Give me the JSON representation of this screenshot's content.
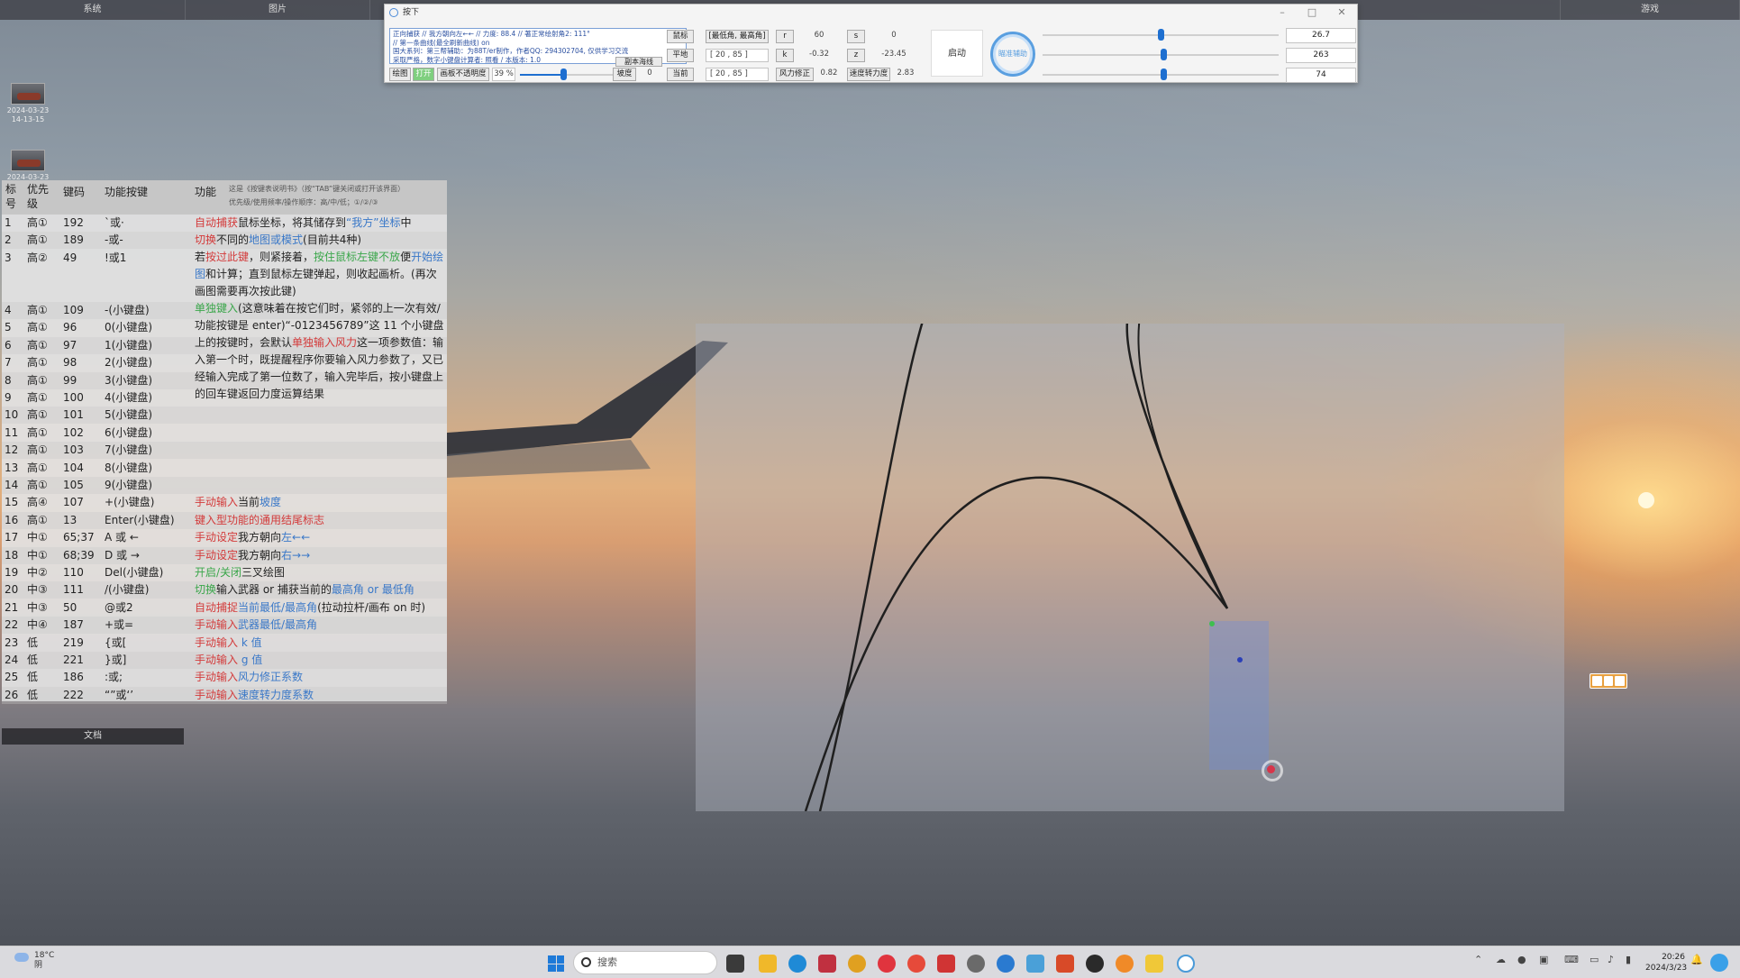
{
  "topbar": {
    "tabs": [
      "系统",
      "图片",
      "游戏"
    ]
  },
  "desktop_icons": [
    {
      "label": "2024-03-23 14-13-15"
    },
    {
      "label": "2024-03-23"
    }
  ],
  "table": {
    "headers": {
      "no": "标号",
      "priority": "优先级",
      "code": "键码",
      "key": "功能按键",
      "fn": "功能"
    },
    "header_note1": "这是《按键表说明书》（按“TAB”键关闭或打开该界面）",
    "header_note2": "优先级/使用频率/操作顺序：高/中/低；①/②/③",
    "rows": [
      {
        "no": "1",
        "pri": "高①",
        "code": "192",
        "key": "`或·",
        "fn": [
          {
            "t": "自动捕获",
            "c": "red"
          },
          {
            "t": "鼠标坐标，将其储存到"
          },
          {
            "t": "“我方”坐标",
            "c": "blue"
          },
          {
            "t": "中"
          }
        ]
      },
      {
        "no": "2",
        "pri": "高①",
        "code": "189",
        "key": "-或-",
        "fn": [
          {
            "t": "切换",
            "c": "red"
          },
          {
            "t": "不同的"
          },
          {
            "t": "地图或模式",
            "c": "blue"
          },
          {
            "t": "(目前共4种)"
          }
        ]
      },
      {
        "no": "3",
        "pri": "高②",
        "code": "49",
        "key": "!或1",
        "fn": []
      },
      {
        "no": "4",
        "pri": "高①",
        "code": "109",
        "key": "-(小键盘)",
        "fn": []
      },
      {
        "no": "5",
        "pri": "高①",
        "code": "96",
        "key": "0(小键盘)",
        "fn": []
      },
      {
        "no": "6",
        "pri": "高①",
        "code": "97",
        "key": "1(小键盘)",
        "fn": []
      },
      {
        "no": "7",
        "pri": "高①",
        "code": "98",
        "key": "2(小键盘)",
        "fn": []
      },
      {
        "no": "8",
        "pri": "高①",
        "code": "99",
        "key": "3(小键盘)",
        "fn": []
      },
      {
        "no": "9",
        "pri": "高①",
        "code": "100",
        "key": "4(小键盘)",
        "fn": []
      },
      {
        "no": "10",
        "pri": "高①",
        "code": "101",
        "key": "5(小键盘)",
        "fn": []
      },
      {
        "no": "11",
        "pri": "高①",
        "code": "102",
        "key": "6(小键盘)",
        "fn": []
      },
      {
        "no": "12",
        "pri": "高①",
        "code": "103",
        "key": "7(小键盘)",
        "fn": []
      },
      {
        "no": "13",
        "pri": "高①",
        "code": "104",
        "key": "8(小键盘)",
        "fn": []
      },
      {
        "no": "14",
        "pri": "高①",
        "code": "105",
        "key": "9(小键盘)",
        "fn": []
      },
      {
        "no": "15",
        "pri": "高④",
        "code": "107",
        "key": "+(小键盘)",
        "fn": [
          {
            "t": "手动输入",
            "c": "red"
          },
          {
            "t": "当前"
          },
          {
            "t": "坡度",
            "c": "blue"
          }
        ]
      },
      {
        "no": "16",
        "pri": "高①",
        "code": "13",
        "key": "Enter(小键盘)",
        "fn": [
          {
            "t": "键入型功能的通用结尾标志",
            "c": "red"
          }
        ]
      },
      {
        "no": "17",
        "pri": "中①",
        "code": "65;37",
        "key": "A 或 ←",
        "fn": [
          {
            "t": "手动设定",
            "c": "red"
          },
          {
            "t": "我方朝向"
          },
          {
            "t": "左←←",
            "c": "blue"
          }
        ]
      },
      {
        "no": "18",
        "pri": "中①",
        "code": "68;39",
        "key": "D 或 →",
        "fn": [
          {
            "t": "手动设定",
            "c": "red"
          },
          {
            "t": "我方朝向"
          },
          {
            "t": "右→→",
            "c": "blue"
          }
        ]
      },
      {
        "no": "19",
        "pri": "中②",
        "code": "110",
        "key": "Del(小键盘)",
        "fn": [
          {
            "t": "开启/关闭",
            "c": "green"
          },
          {
            "t": "三叉绘图"
          }
        ]
      },
      {
        "no": "20",
        "pri": "中③",
        "code": "111",
        "key": "/(小键盘)",
        "fn": [
          {
            "t": "切换",
            "c": "green"
          },
          {
            "t": "输入武器 or 捕获当前的"
          },
          {
            "t": "最高角 or 最低角",
            "c": "blue"
          }
        ]
      },
      {
        "no": "21",
        "pri": "中③",
        "code": "50",
        "key": "@或2",
        "fn": [
          {
            "t": "自动捕捉",
            "c": "red"
          },
          {
            "t": "当前最低/最高角",
            "c": "blue"
          },
          {
            "t": "(拉动拉杆/画布 on 时)"
          }
        ]
      },
      {
        "no": "22",
        "pri": "中④",
        "code": "187",
        "key": "+或=",
        "fn": [
          {
            "t": "手动输入",
            "c": "red"
          },
          {
            "t": "武器最低/最高角",
            "c": "blue"
          }
        ]
      },
      {
        "no": "23",
        "pri": "低",
        "code": "219",
        "key": "{或[",
        "fn": [
          {
            "t": "手动输入",
            "c": "red"
          },
          {
            "t": " k 值",
            "c": "blue"
          }
        ]
      },
      {
        "no": "24",
        "pri": "低",
        "code": "221",
        "key": "}或]",
        "fn": [
          {
            "t": "手动输入",
            "c": "red"
          },
          {
            "t": " g 值",
            "c": "blue"
          }
        ]
      },
      {
        "no": "25",
        "pri": "低",
        "code": "186",
        "key": ":或;",
        "fn": [
          {
            "t": "手动输入",
            "c": "red"
          },
          {
            "t": "风力修正系数",
            "c": "blue"
          }
        ]
      },
      {
        "no": "26",
        "pri": "低",
        "code": "222",
        "key": "“”或‘’",
        "fn": [
          {
            "t": "手动输入",
            "c": "red"
          },
          {
            "t": "速度转力度系数",
            "c": "blue"
          }
        ]
      }
    ],
    "desc_row3": [
      {
        "t": "若"
      },
      {
        "t": "按过此键",
        "c": "red"
      },
      {
        "t": "，则紧接着，"
      },
      {
        "t": "按住鼠标左键不放",
        "c": "green"
      },
      {
        "t": "便"
      },
      {
        "t": "开始绘图",
        "c": "blue"
      },
      {
        "t": "和计算；直到鼠标左键弹起，则收起画析。(再次画图需要再次按此键)"
      }
    ],
    "desc_row4": [
      {
        "t": "单独键入",
        "c": "green"
      },
      {
        "t": "(这意味着在按它们时，紧邻的上一次有效/功能按键是 enter)“-0123456789”这 11 个小键盘上的按键时，会默认"
      },
      {
        "t": "单独输入风力",
        "c": "red"
      },
      {
        "t": "这一项参数值：输入第一个时，既提醒程序你要输入风力参数了，又已经输入完成了第一位数了，输入完毕后，按小键盘上的回车键返回力度运算结果"
      }
    ]
  },
  "doc_label": "文档",
  "tool": {
    "title": "按下",
    "info_lines": [
      "正向捕获 // 我方朝向左←← // 力度: 88.4 // 著正常绘射角2: 111°",
      "// 第一条曲线(最全刷新曲线) on",
      "国大系列：第三帮辅助：为88T/er制作，作者QQ: 294302704, 仅供学习交流",
      "采取严格，数字小键盘计算者: 照看 / 本版本: 1.0",
      "副本海线"
    ],
    "buttons": {
      "draw": "绘图",
      "open": "打开",
      "canvas_opacity": "画板不透明度",
      "opacity_value": "39 %",
      "slope": "坡度",
      "slope_value": "0",
      "mouse": "鼠标",
      "flat": "平地",
      "current": "当前",
      "range_label": "[最低角, 最高角]",
      "range1": "[ 20 , 85 ]",
      "range2": "[ 20 , 85 ]",
      "wind_fix": "风力修正",
      "wind_fix_value": "0.82",
      "speed_power": "速度转力度",
      "speed_power_value": "2.83",
      "r_label": "r",
      "r_value": "60",
      "k_label": "k",
      "k_value": "-0.32",
      "s_label": "s",
      "s_value": "0",
      "z_label": "z",
      "z_value": "-23.45",
      "start": "启动",
      "ring": "瞄准辅助"
    },
    "values": [
      "26.7",
      "263",
      "74"
    ],
    "sliders": [
      0.5,
      0.51,
      0.51
    ],
    "opacity_fraction": 0.39
  },
  "taskbar": {
    "weather_temp": "18°C",
    "weather_desc": "阴",
    "search_placeholder": "搜索",
    "time": "20:26",
    "date": "2024/3/23"
  }
}
